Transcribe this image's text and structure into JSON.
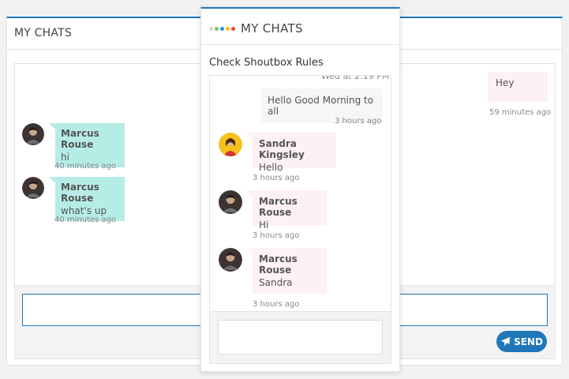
{
  "background_widget": {
    "title": "MY CHATS",
    "send_label": "SEND",
    "messages": [
      {
        "name": "Marcus Rouse",
        "text": "hi",
        "time": "40 minutes ago"
      },
      {
        "name": "Marcus Rouse",
        "text": "what's up",
        "time": "40 minutes ago"
      }
    ],
    "own_message": {
      "text": "Hey",
      "time": "59 minutes ago"
    }
  },
  "foreground_widget": {
    "title": "MY CHATS",
    "rules_link": "Check Shoutbox Rules",
    "partial_time": "Wed at 2:19 PM",
    "own_message": {
      "text": "Hello Good Morning to all",
      "time": "3 hours ago"
    },
    "messages": [
      {
        "name": "Sandra Kingsley",
        "text": "Hello",
        "time": "3 hours ago"
      },
      {
        "name": "Marcus Rouse",
        "text": "Hi",
        "time": "3 hours ago"
      },
      {
        "name": "Marcus Rouse",
        "text": "Sandra",
        "time": "3 hours ago"
      }
    ]
  },
  "colors": {
    "accent": "#1f77b9",
    "teal_bubble": "#b6ece6",
    "pink_bubble": "#fdf1f4"
  },
  "icons": {
    "send": "paper-plane-icon",
    "brand": "colored-dots-icon"
  }
}
